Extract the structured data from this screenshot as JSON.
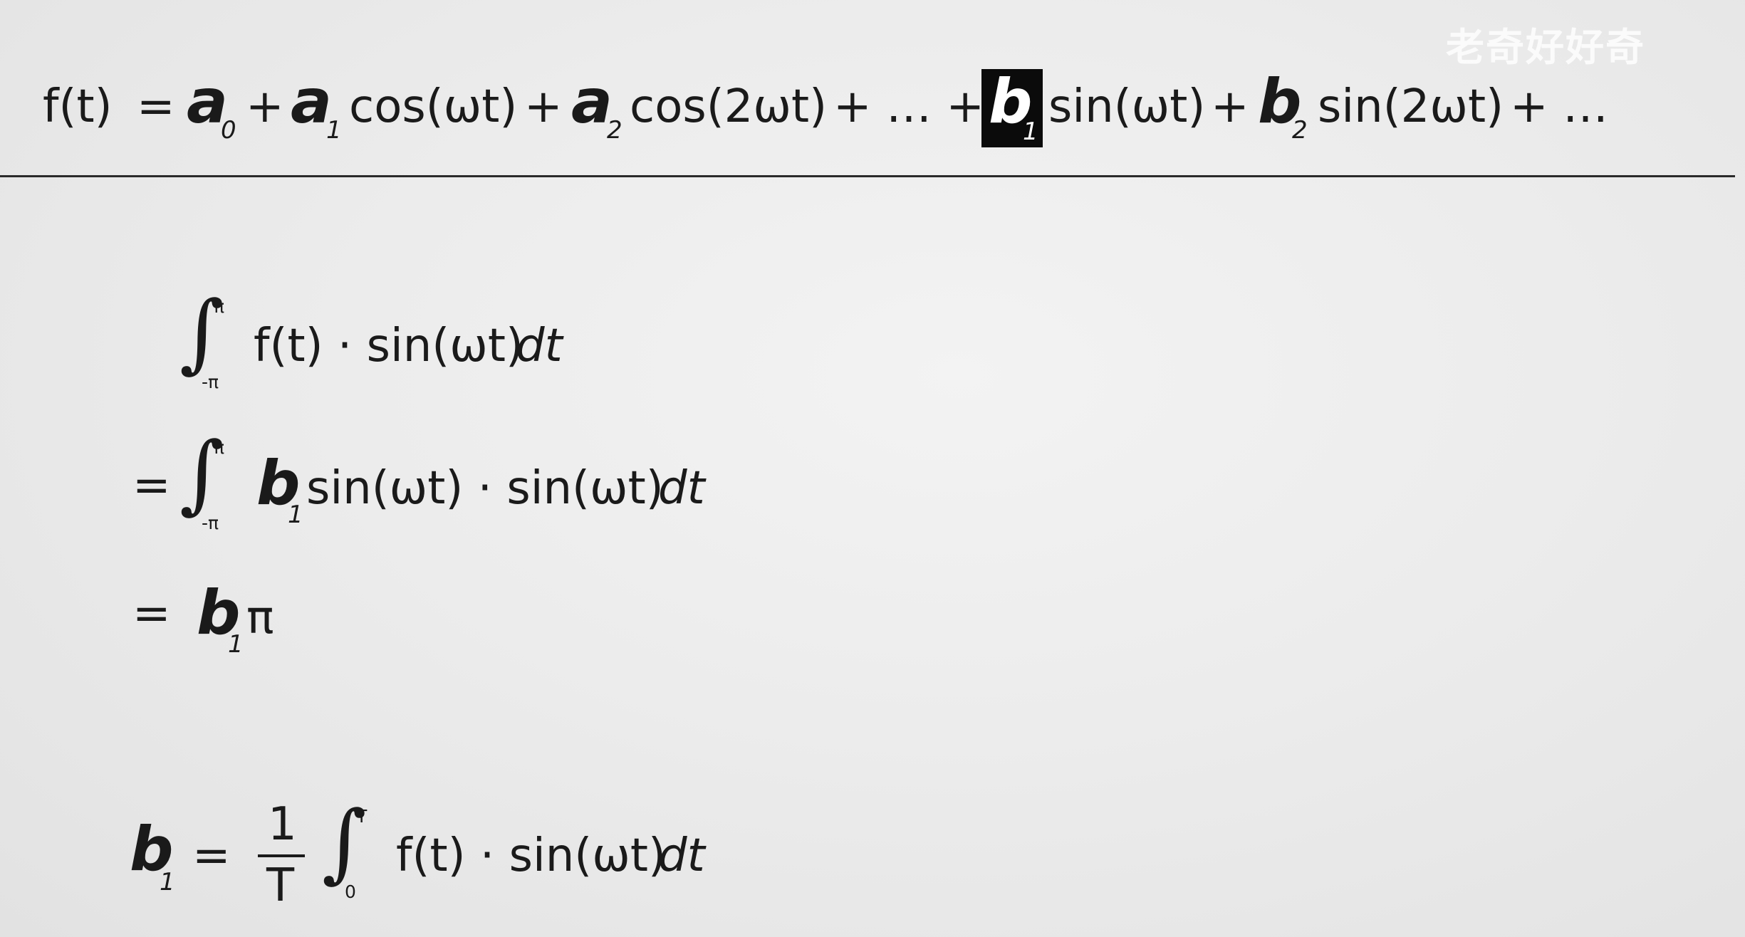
{
  "watermark": "老奇好好奇",
  "main_formula": {
    "f_t": "f(t)",
    "equals": "=",
    "a0_symbol": "a",
    "a0_sub": "0",
    "plus1": "+",
    "a1_symbol": "a",
    "a1_sub": "1",
    "term_cos_wt": "cos(ωt)",
    "plus2": "+",
    "a2_symbol": "a",
    "a2_sub": "2",
    "term_cos_2wt": "cos(2ωt)",
    "plus_ellipsis": "+ … +",
    "b1_symbol": "b",
    "b1_sub": "1",
    "term_sin_wt": "sin(ωt)",
    "plus3": "+",
    "b2_symbol": "b",
    "b2_sub": "2",
    "term_sin_2wt": "sin(2ωt)",
    "tail": "+ …",
    "highlighted_term": "b1"
  },
  "derivation": {
    "line1": {
      "integral": "∫",
      "upper": "π",
      "lower": "-π",
      "integrand": "f(t) · sin(ωt)",
      "dt": "dt"
    },
    "line2": {
      "equals": "=",
      "integral": "∫",
      "upper": "π",
      "lower": "-π",
      "b_symbol": "b",
      "b_sub": "1",
      "integrand": "sin(ωt) · sin(ωt)",
      "dt": "dt"
    },
    "line3": {
      "equals": "=",
      "b_symbol": "b",
      "b_sub": "1",
      "pi": "π"
    }
  },
  "result": {
    "b_symbol": "b",
    "b_sub": "1",
    "equals": "=",
    "numerator": "1",
    "denominator": "T",
    "integral": "∫",
    "upper": "T",
    "lower": "0",
    "integrand": "f(t) · sin(ωt)",
    "dt": "dt"
  }
}
